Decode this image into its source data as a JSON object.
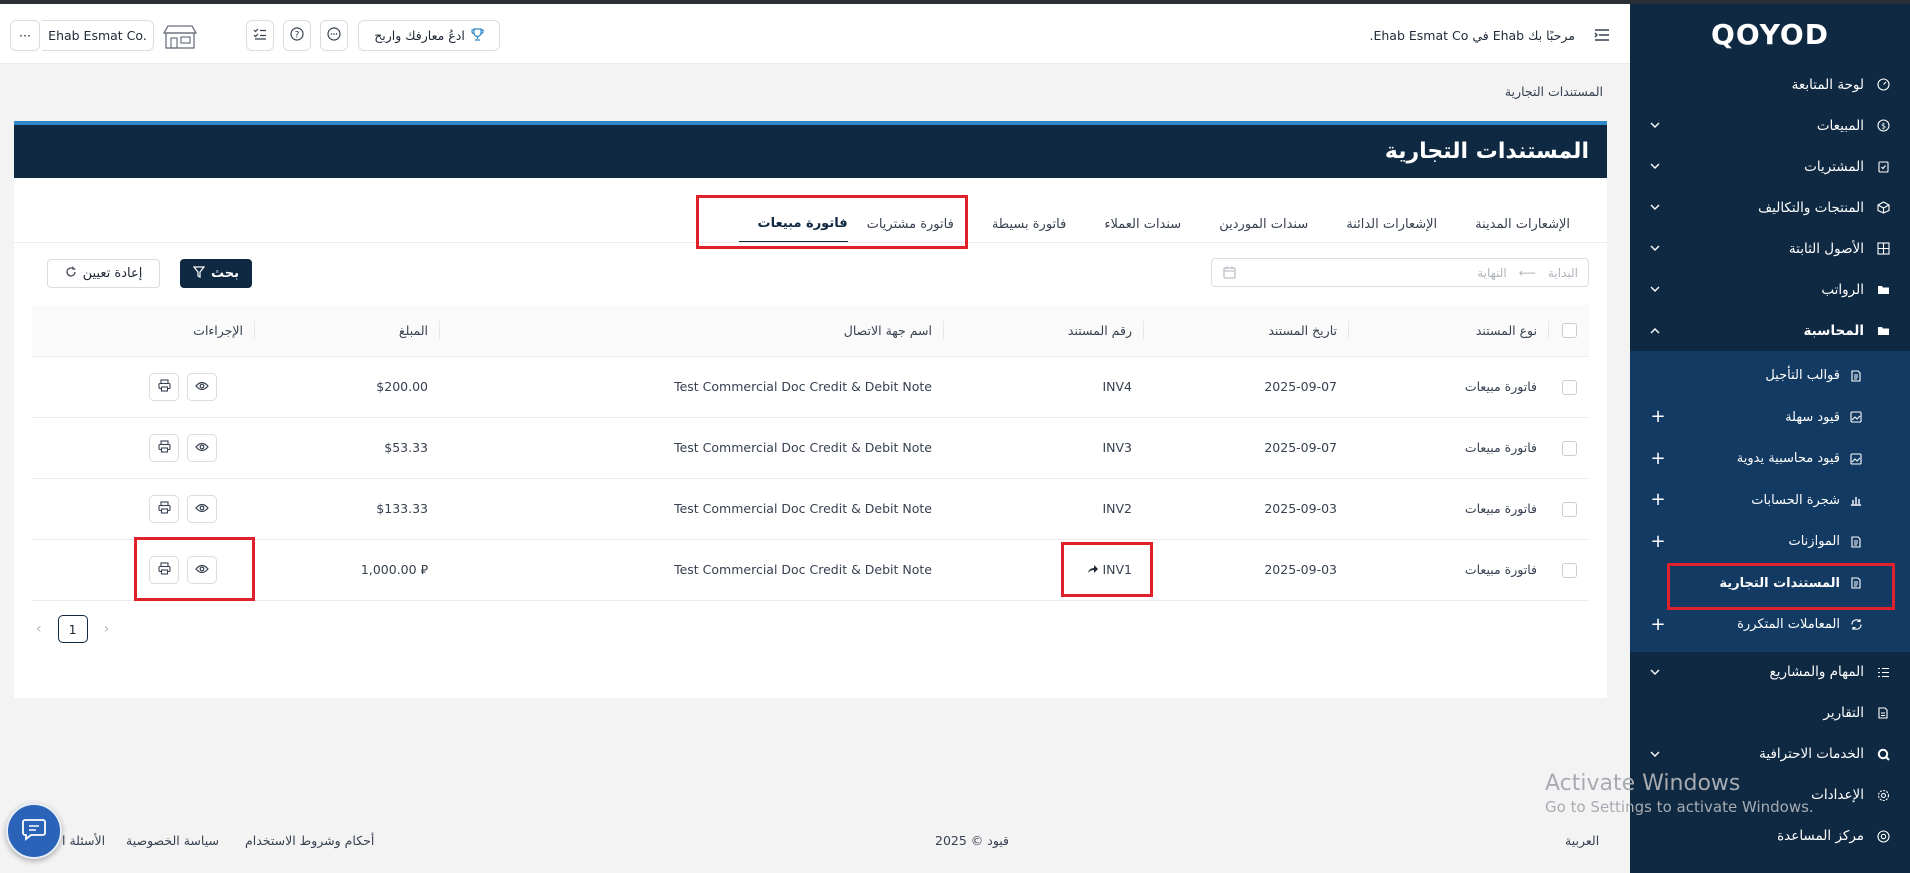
{
  "app": {
    "logo": "QOYOD",
    "welcome": "مرحبًا بك Ehab في Ehab Esmat Co.",
    "company_selector": "Ehab Esmat Co.",
    "refer_button": "ادعُ معارفك واربح",
    "more_label": "···"
  },
  "sidebar": {
    "items": [
      {
        "label": "لوحة المتابعة",
        "icon": "dashboard-icon",
        "has_chevron": false
      },
      {
        "label": "المبيعات",
        "icon": "dollar-icon",
        "has_chevron": true
      },
      {
        "label": "المشتريات",
        "icon": "clipboard-icon",
        "has_chevron": true
      },
      {
        "label": "المنتجات والتكاليف",
        "icon": "box-icon",
        "has_chevron": true
      },
      {
        "label": "الأصول الثابتة",
        "icon": "grid-icon",
        "has_chevron": true
      },
      {
        "label": "الرواتب",
        "icon": "folder-icon",
        "has_chevron": true
      },
      {
        "label": "المحاسبة",
        "icon": "folder-icon",
        "has_chevron": true,
        "expanded": true
      }
    ],
    "accounting_children": [
      {
        "label": "قوالب التأجيل",
        "icon": "doc-icon",
        "plus": false
      },
      {
        "label": "قيود سهلة",
        "icon": "image-icon",
        "plus": true
      },
      {
        "label": "قيود محاسبية يدوية",
        "icon": "image-icon",
        "plus": true
      },
      {
        "label": "شجرة الحسابات",
        "icon": "bar-chart-icon",
        "plus": true
      },
      {
        "label": "الموازنات",
        "icon": "doc-icon",
        "plus": true
      },
      {
        "label": "المستندات التجارية",
        "icon": "doc-icon",
        "plus": false,
        "current": true
      },
      {
        "label": "المعاملات المتكررة",
        "icon": "refresh-icon",
        "plus": true
      }
    ],
    "bottom_items": [
      {
        "label": "المهام والمشاريع",
        "icon": "list-icon",
        "has_chevron": true
      },
      {
        "label": "التقارير",
        "icon": "report-icon",
        "has_chevron": false
      },
      {
        "label": "الخدمات الاحترافية",
        "icon": "search-icon",
        "has_chevron": true
      },
      {
        "label": "الإعدادات",
        "icon": "gear-icon",
        "has_chevron": false
      },
      {
        "label": "مركز المساعدة",
        "icon": "help-icon",
        "has_chevron": false
      }
    ]
  },
  "page": {
    "breadcrumb": "المستندات التجارية",
    "title": "المستندات التجارية",
    "tabs": [
      {
        "label": "فاتورة مبيعات",
        "active": true
      },
      {
        "label": "فاتورة مشتريات",
        "active": false
      },
      {
        "label": "فاتورة بسيطة",
        "active": false
      },
      {
        "label": "سندات العملاء",
        "active": false
      },
      {
        "label": "سندات الموردين",
        "active": false
      },
      {
        "label": "الإشعارات الدائنة",
        "active": false
      },
      {
        "label": "الإشعارات المدينة",
        "active": false
      }
    ],
    "filters": {
      "start_placeholder": "البداية",
      "end_placeholder": "النهاية",
      "search_button": "بحث",
      "reset_button": "إعادة تعيين"
    }
  },
  "table": {
    "headers": [
      "نوع المستند",
      "تاريخ المستند",
      "رقم المستند",
      "اسم جهة الاتصال",
      "المبلغ",
      "الإجراءات"
    ],
    "rows": [
      {
        "type": "فاتورة مبيعات",
        "date": "2025-09-07",
        "number": "INV4",
        "contact": "Test Commercial Doc Credit & Debit Note",
        "amount": "$200.00",
        "linked": false
      },
      {
        "type": "فاتورة مبيعات",
        "date": "2025-09-07",
        "number": "INV3",
        "contact": "Test Commercial Doc Credit & Debit Note",
        "amount": "$53.33",
        "linked": false
      },
      {
        "type": "فاتورة مبيعات",
        "date": "2025-09-03",
        "number": "INV2",
        "contact": "Test Commercial Doc Credit & Debit Note",
        "amount": "$133.33",
        "linked": false
      },
      {
        "type": "فاتورة مبيعات",
        "date": "2025-09-03",
        "number": "INV1",
        "contact": "Test Commercial Doc Credit & Debit Note",
        "amount": "⃁ 1,000.00",
        "linked": true
      }
    ]
  },
  "pagination": {
    "current": "1",
    "prev": "‹",
    "next": "›"
  },
  "footer": {
    "language": "العربية",
    "copyright": "قيود © 2025",
    "terms": "أحكام وشروط الاستخدام",
    "privacy": "سياسة الخصوصية",
    "faq": "الأسئلة ا"
  },
  "watermark": {
    "line1": "Activate Windows",
    "line2": "Go to Settings to activate Windows."
  },
  "colors": {
    "navy": "#0f2942",
    "sub_nav": "#133a62",
    "accent_blue": "#2f86c8",
    "highlight_red": "#e0202a"
  }
}
